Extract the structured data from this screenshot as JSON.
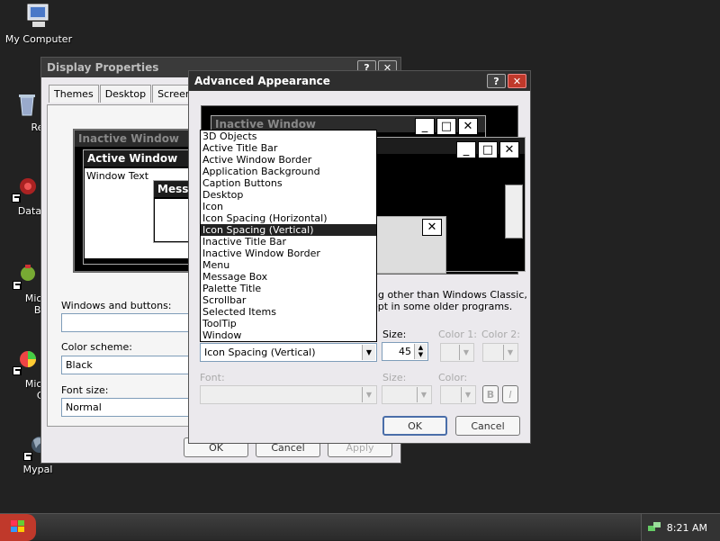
{
  "desktop": {
    "icons": [
      {
        "label": "My Computer"
      },
      {
        "label": "Recyc"
      },
      {
        "label": "DataWag"
      },
      {
        "label": "Microsol"
      },
      {
        "label": "Basic"
      },
      {
        "label": "Microsol"
      },
      {
        "label": "C++"
      },
      {
        "label": "Mypal"
      }
    ]
  },
  "display_properties": {
    "title": "Display Properties",
    "tabs": [
      "Themes",
      "Desktop",
      "Screen S"
    ],
    "preview": {
      "inactive_title": "Inactive Window",
      "active_title": "Active Window",
      "window_text": "Window Text",
      "message_title": "Messa"
    },
    "windows_buttons_label": "Windows and buttons:",
    "color_scheme_label": "Color scheme:",
    "color_scheme_value": "Black",
    "font_size_label": "Font size:",
    "font_size_value": "Normal",
    "ok_label": "OK",
    "cancel_label": "Cancel",
    "apply_label": "Apply"
  },
  "advanced": {
    "title": "Advanced Appearance",
    "help_glyph": "?",
    "close_glyph": "✕",
    "preview": {
      "inactive_title": "Inactive Window"
    },
    "note_line1": "ng other than Windows Classic,",
    "note_line2": "ept in some older programs.",
    "item_label": "Item:",
    "item_value": "Icon Spacing (Vertical)",
    "size_label": "Size:",
    "size_value": "45",
    "color1_label": "Color 1:",
    "color2_label": "Color 2:",
    "font_label": "Font:",
    "font_size_label": "Size:",
    "font_color_label": "Color:",
    "bold_label": "B",
    "italic_label": "I",
    "ok_label": "OK",
    "cancel_label": "Cancel",
    "item_options": [
      "3D Objects",
      "Active Title Bar",
      "Active Window Border",
      "Application Background",
      "Caption Buttons",
      "Desktop",
      "Icon",
      "Icon Spacing (Horizontal)",
      "Icon Spacing (Vertical)",
      "Inactive Title Bar",
      "Inactive Window Border",
      "Menu",
      "Message Box",
      "Palette Title",
      "Scrollbar",
      "Selected Items",
      "ToolTip",
      "Window"
    ],
    "selected_index": 8
  },
  "taskbar": {
    "time": "8:21 AM"
  },
  "colors": {
    "desktop_bg": "#222222",
    "start_button": "#c0392b",
    "selected_item_bg": "#222222"
  }
}
